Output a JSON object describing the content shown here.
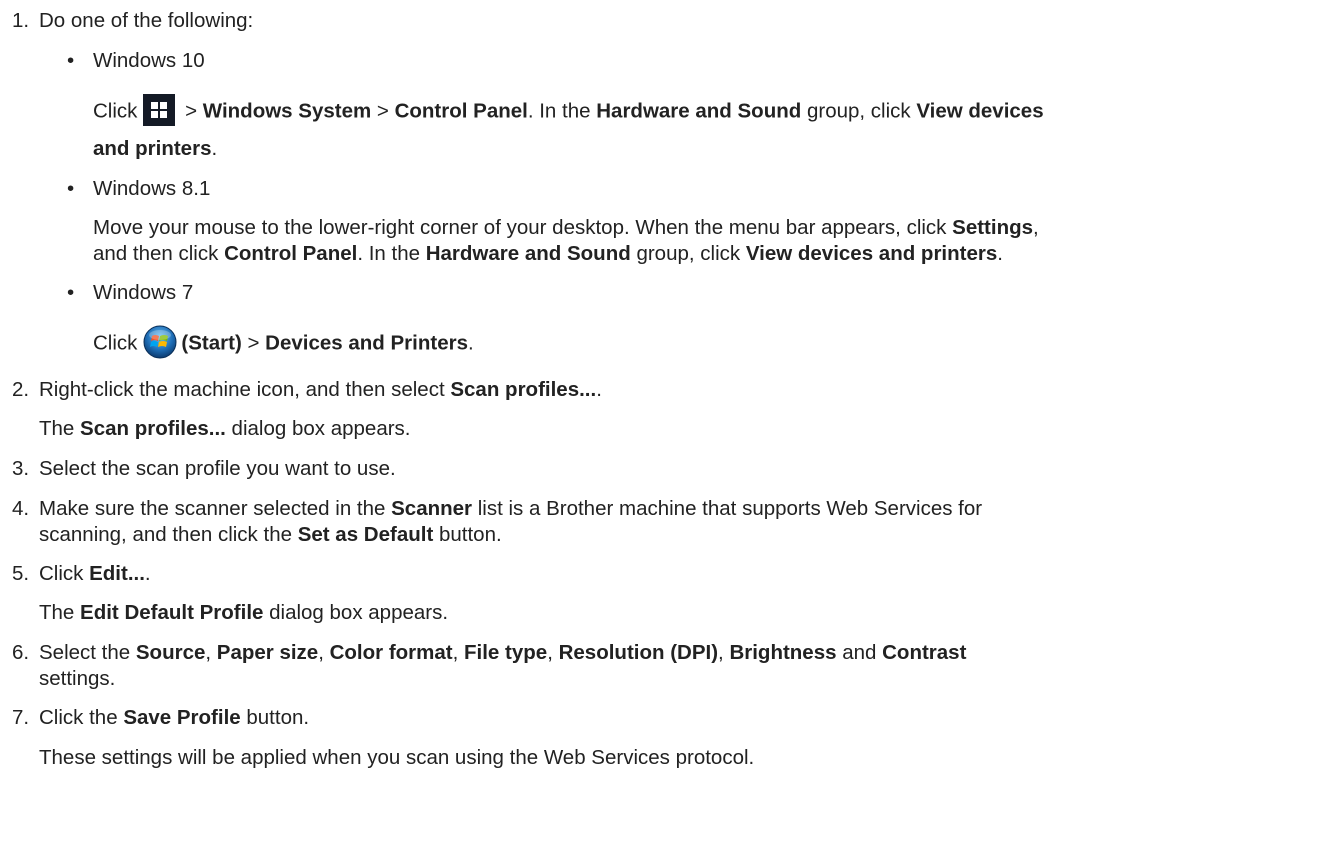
{
  "steps": [
    {
      "num": "1.",
      "text": "Do one of the following:"
    },
    {
      "num": "2.",
      "pre": "Right-click the machine icon, and then select ",
      "bold": "Scan profiles...",
      "post": "."
    },
    {
      "num": "3.",
      "text": "Select the scan profile you want to use."
    },
    {
      "num": "4.",
      "l1_pre": "Make sure the scanner selected in the ",
      "l1_bold": "Scanner",
      "l1_post": " list is a Brother machine that supports Web Services for",
      "l2_pre": "scanning, and then click the ",
      "l2_bold": "Set as Default",
      "l2_post": " button."
    },
    {
      "num": "5.",
      "pre": "Click ",
      "bold": "Edit...",
      "post": "."
    },
    {
      "num": "6.",
      "pre": "Select the ",
      "b1": "Source",
      "s1": ", ",
      "b2": "Paper size",
      "s2": ", ",
      "b3": "Color format",
      "s3": ", ",
      "b4": "File type",
      "s4": ", ",
      "b5": "Resolution (DPI)",
      "s5": ", ",
      "b6": "Brightness",
      "s6": " and ",
      "b7": "Contrast",
      "l2": "settings."
    },
    {
      "num": "7.",
      "pre": "Click the ",
      "bold": "Save Profile",
      "post": " button."
    }
  ],
  "step2_note": {
    "pre": "The ",
    "bold": "Scan profiles...",
    "post": " dialog box appears."
  },
  "step5_note": {
    "pre": "The ",
    "bold": "Edit Default Profile",
    "post": " dialog box appears."
  },
  "step7_note": "These settings will be applied when you scan using the Web Services protocol.",
  "bullet_char": "•",
  "win10": {
    "label": "Windows 10",
    "click": "Click",
    "sep1": " > ",
    "b1": "Windows System",
    "sep2": " > ",
    "b2": "Control Panel",
    "mid": ". In the ",
    "b3": "Hardware and Sound",
    "mid2": " group, click ",
    "b4": "View devices",
    "b5": "and printers",
    "end": ".",
    "icon": "windows-10-start-icon",
    "icon_bg": "#141a26"
  },
  "win81": {
    "label": "Windows 8.1",
    "l1_pre": "Move your mouse to the lower-right corner of your desktop. When the menu bar appears, click ",
    "l1_bold": "Settings",
    "l1_post": ",",
    "l2_pre": "and then click ",
    "l2_b1": "Control Panel",
    "l2_mid": ". In the ",
    "l2_b2": "Hardware and Sound",
    "l2_mid2": " group, click ",
    "l2_b3": "View devices and printers",
    "l2_end": "."
  },
  "win7": {
    "label": "Windows 7",
    "click": "Click",
    "b1": "(Start)",
    "sep": " > ",
    "b2": "Devices and Printers",
    "end": ".",
    "icon": "windows-7-start-orb-icon"
  }
}
